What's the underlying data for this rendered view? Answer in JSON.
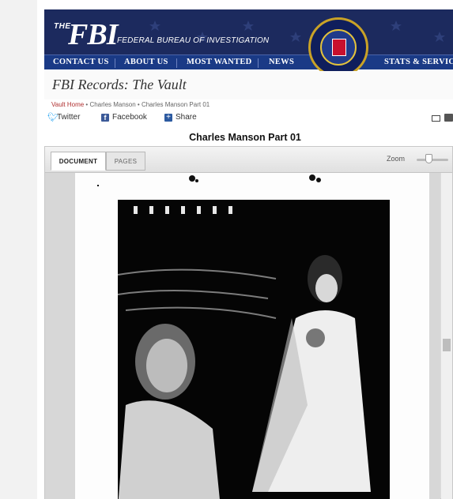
{
  "header": {
    "the": "THE",
    "fbi": "FBI",
    "subtitle": "FEDERAL BUREAU OF INVESTIGATION",
    "nav": [
      "CONTACT US",
      "ABOUT US",
      "MOST WANTED",
      "NEWS",
      "STATS & SERVICES"
    ],
    "seal_icon": "fbi-seal-icon"
  },
  "vault": {
    "title": "FBI Records: The Vault"
  },
  "breadcrumb": {
    "home": "Vault Home",
    "sep": " • ",
    "parent": "Charles Manson",
    "current": "Charles Manson Part 01"
  },
  "share": {
    "twitter": "Twitter",
    "facebook": "Facebook",
    "share": "Share"
  },
  "document": {
    "title": "Charles Manson Part 01"
  },
  "viewer": {
    "tabs": [
      "DOCUMENT",
      "PAGES"
    ],
    "active_tab": "DOCUMENT",
    "zoom_label": "Zoom"
  },
  "colors": {
    "header_navy": "#1c2a5e",
    "nav_blue": "#1a3a86",
    "link_red": "#b03030"
  }
}
